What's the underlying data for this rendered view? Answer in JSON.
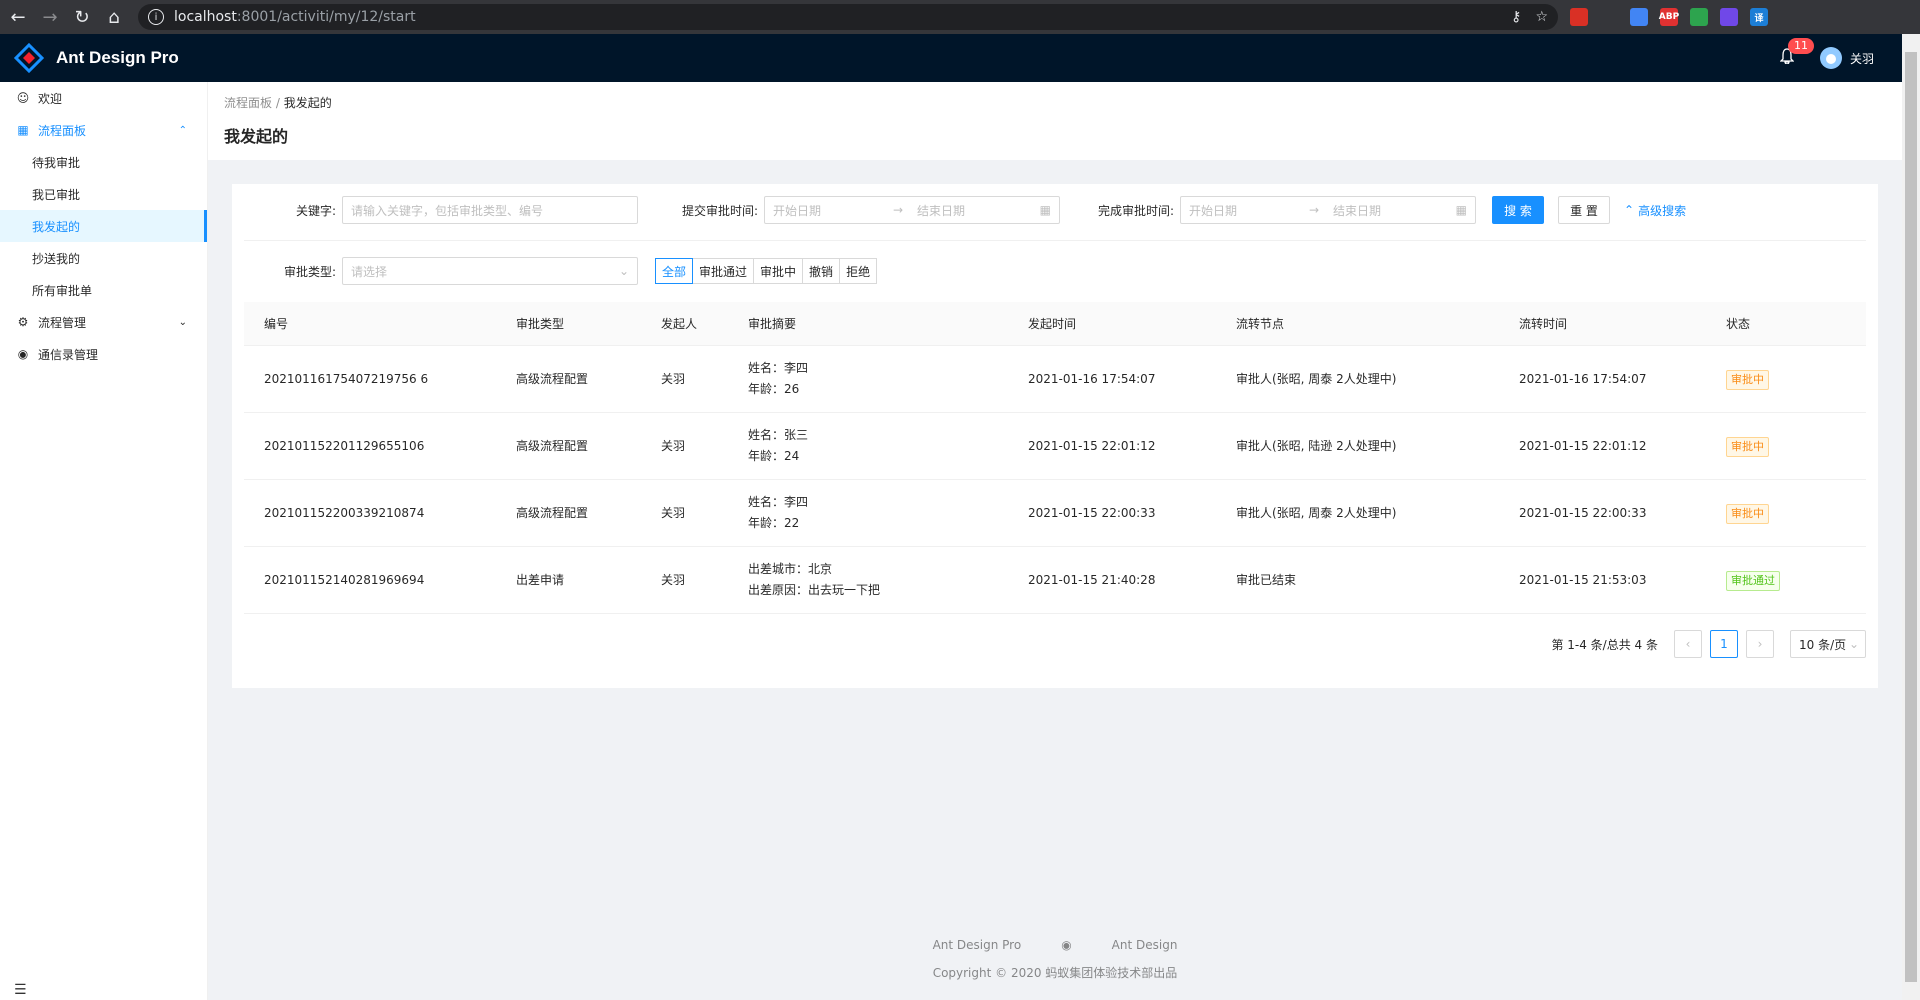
{
  "browser": {
    "url_host": "localhost",
    "url_path": ":8001/activiti/my/12/start",
    "extensions": [
      {
        "name": "ext-red-icon",
        "color": "#d93025",
        "text": ""
      },
      {
        "name": "vue-devtools-icon",
        "color": "#35363a",
        "text": ""
      },
      {
        "name": "translate-icon",
        "color": "#4285f4",
        "text": ""
      },
      {
        "name": "adblock-icon",
        "color": "#e03131",
        "text": "ABP"
      },
      {
        "name": "shield-icon",
        "color": "#2da44e",
        "text": ""
      },
      {
        "name": "ext-react-icon",
        "color": "#7048e8",
        "text": ""
      },
      {
        "name": "ext-translate-icon",
        "color": "#1c7ed6",
        "text": "译"
      },
      {
        "name": "puzzle-icon",
        "color": "#35363a",
        "text": ""
      }
    ]
  },
  "header": {
    "title": "Ant Design Pro",
    "notification_count": "11",
    "username": "关羽"
  },
  "sidebar": {
    "items": [
      {
        "label": "欢迎",
        "icon": "smile-icon"
      },
      {
        "label": "流程面板",
        "icon": "form-icon"
      },
      {
        "label": "待我审批"
      },
      {
        "label": "我已审批"
      },
      {
        "label": "我发起的"
      },
      {
        "label": "抄送我的"
      },
      {
        "label": "所有审批单"
      },
      {
        "label": "流程管理",
        "icon": "cluster-icon"
      },
      {
        "label": "通信录管理",
        "icon": "github-icon"
      }
    ]
  },
  "page": {
    "breadcrumb_parent": "流程面板",
    "breadcrumb_current": "我发起的",
    "title": "我发起的"
  },
  "filters": {
    "keyword_label": "关键字:",
    "keyword_placeholder": "请输入关键字，包括审批类型、编号",
    "submit_time_label": "提交审批时间:",
    "finish_time_label": "完成审批时间:",
    "start_placeholder": "开始日期",
    "end_placeholder": "结束日期",
    "search_label": "搜 索",
    "reset_label": "重 置",
    "advanced_label": "高级搜索",
    "type_label": "审批类型:",
    "type_placeholder": "请选择",
    "status_options": [
      "全部",
      "审批通过",
      "审批中",
      "撤销",
      "拒绝"
    ]
  },
  "table": {
    "columns": [
      "编号",
      "审批类型",
      "发起人",
      "审批摘要",
      "发起时间",
      "流转节点",
      "流转时间",
      "状态"
    ],
    "rows": [
      {
        "id": "20210116175407219756 6",
        "type": "高级流程配置",
        "initiator": "关羽",
        "summary1": "姓名：李四",
        "summary2": "年龄：26",
        "start": "2021-01-16 17:54:07",
        "node": "审批人(张昭, 周泰 2人处理中)",
        "flow_time": "2021-01-16 17:54:07",
        "status": "审批中",
        "status_kind": "warn"
      },
      {
        "id": "202101152201129655106",
        "type": "高级流程配置",
        "initiator": "关羽",
        "summary1": "姓名：张三",
        "summary2": "年龄：24",
        "start": "2021-01-15 22:01:12",
        "node": "审批人(张昭, 陆逊 2人处理中)",
        "flow_time": "2021-01-15 22:01:12",
        "status": "审批中",
        "status_kind": "warn"
      },
      {
        "id": "202101152200339210874",
        "type": "高级流程配置",
        "initiator": "关羽",
        "summary1": "姓名：李四",
        "summary2": "年龄：22",
        "start": "2021-01-15 22:00:33",
        "node": "审批人(张昭, 周泰 2人处理中)",
        "flow_time": "2021-01-15 22:00:33",
        "status": "审批中",
        "status_kind": "warn"
      },
      {
        "id": "202101152140281969694",
        "type": "出差申请",
        "initiator": "关羽",
        "summary1": "出差城市：北京",
        "summary2": "出差原因：出去玩一下把",
        "start": "2021-01-15 21:40:28",
        "node": "审批已结束",
        "flow_time": "2021-01-15 21:53:03",
        "status": "审批通过",
        "status_kind": "ok"
      }
    ]
  },
  "pagination": {
    "total_text": "第 1-4 条/总共 4 条",
    "current_page": "1",
    "page_size": "10 条/页"
  },
  "footer": {
    "link1": "Ant Design Pro",
    "link2": "Ant Design",
    "copyright": "Copyright © 2020 蚂蚁集团体验技术部出品"
  }
}
